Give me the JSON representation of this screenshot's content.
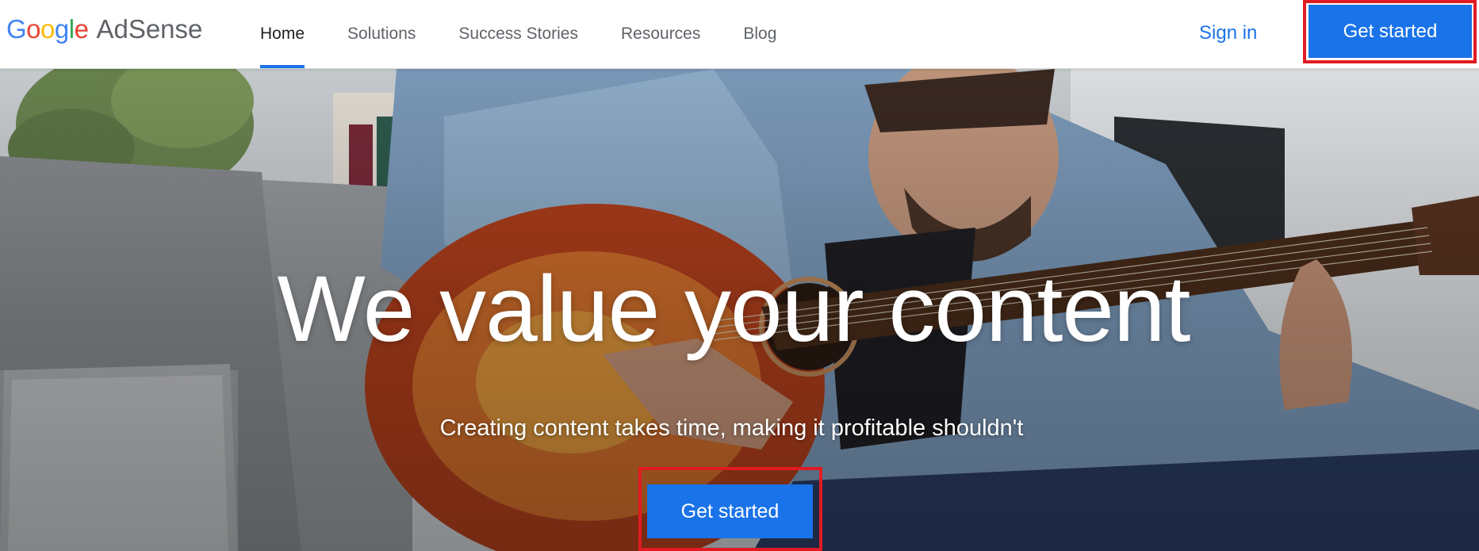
{
  "brand": {
    "logo_letters": [
      {
        "char": "G",
        "color": "#4285F4"
      },
      {
        "char": "o",
        "color": "#EA4335"
      },
      {
        "char": "o",
        "color": "#FBBC05"
      },
      {
        "char": "g",
        "color": "#4285F4"
      },
      {
        "char": "l",
        "color": "#34A853"
      },
      {
        "char": "e",
        "color": "#EA4335"
      }
    ],
    "product": "AdSense"
  },
  "nav": {
    "items": [
      {
        "label": "Home",
        "active": true
      },
      {
        "label": "Solutions",
        "active": false
      },
      {
        "label": "Success Stories",
        "active": false
      },
      {
        "label": "Resources",
        "active": false
      },
      {
        "label": "Blog",
        "active": false
      }
    ]
  },
  "header": {
    "signin_label": "Sign in",
    "cta_label": "Get started"
  },
  "hero": {
    "headline": "We value your content",
    "subheadline": "Creating content takes time, making it profitable shouldn't",
    "cta_label": "Get started",
    "image_description": "man-playing-acoustic-guitar-on-sofa"
  },
  "colors": {
    "accent": "#1a73e8",
    "highlight_outline": "#e11b22",
    "nav_text": "#5f6368"
  }
}
